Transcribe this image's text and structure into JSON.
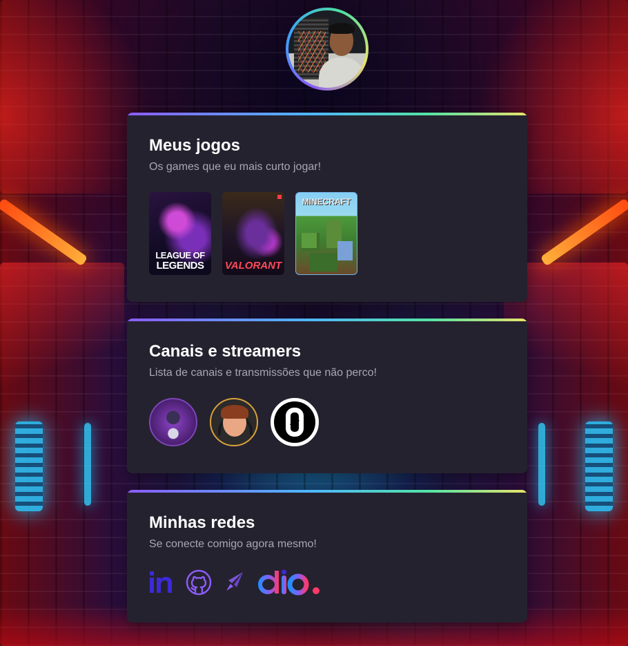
{
  "colors": {
    "card_bg": "#25222f",
    "title": "#ffffff",
    "subtitle": "#a9a7b6",
    "accent_gradient": [
      "#8b5cf6",
      "#4fb6ff",
      "#53e3a6",
      "#e8e36a"
    ],
    "linkedin": "#3b2bd6",
    "github": "#8b5cf6",
    "dio_gradient": [
      "#1e90ff",
      "#8b5cf6",
      "#ff3b6b"
    ]
  },
  "profile": {
    "avatar_icon": "profile-photo"
  },
  "games_card": {
    "title": "Meus jogos",
    "subtitle": "Os games que eu mais curto jogar!",
    "games": [
      {
        "name": "league-of-legends",
        "logo_line1": "LEAGUE OF",
        "logo_line2": "LEGENDS"
      },
      {
        "name": "valorant",
        "logo": "VALORANT"
      },
      {
        "name": "minecraft",
        "logo": "MINECRAFT"
      }
    ]
  },
  "channels_card": {
    "title": "Canais e streamers",
    "subtitle": "Lista de canais e transmissões que não perco!",
    "channels": [
      "channel-avatar-1",
      "channel-avatar-2",
      "channel-avatar-3"
    ]
  },
  "socials_card": {
    "title": "Minhas redes",
    "subtitle": "Se conecte comigo agora mesmo!",
    "links": [
      {
        "icon": "linkedin-icon",
        "label": "in"
      },
      {
        "icon": "github-icon"
      },
      {
        "icon": "rocket-icon"
      },
      {
        "icon": "dio-icon",
        "label": "dio"
      }
    ]
  }
}
